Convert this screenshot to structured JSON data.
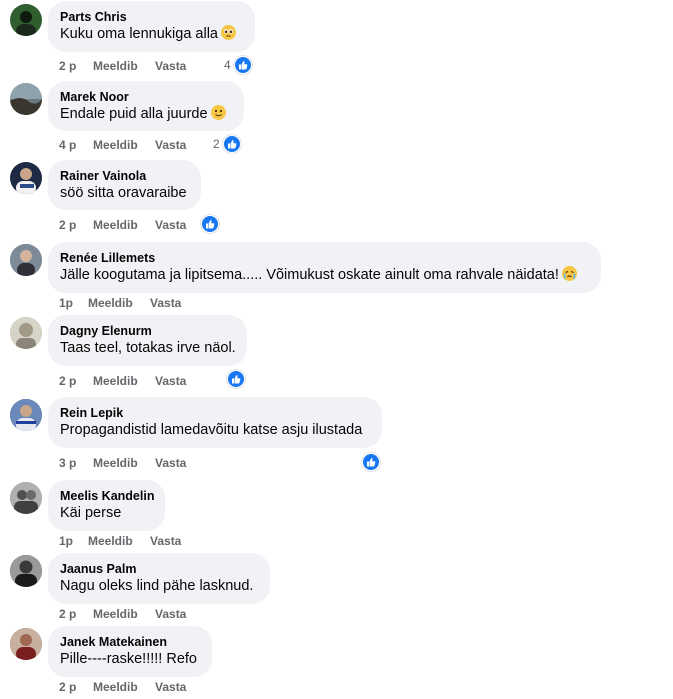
{
  "comments": [
    {
      "author": "Parts Chris",
      "text": "Kuku oma lennukiga alla",
      "emoji": "pleading-face-icon",
      "time": "2 p",
      "like": "Meeldib",
      "reply": "Vasta",
      "reactions": "4",
      "avatar_color": "#2e5a2e"
    },
    {
      "author": "Marek Noor",
      "text": "Endale puid alla juurde",
      "emoji": "slightly-smiling-face-icon",
      "time": "4 p",
      "like": "Meeldib",
      "reply": "Vasta",
      "reactions": "2",
      "avatar_color": "#6b7a80"
    },
    {
      "author": "Rainer Vainola",
      "text": "söö sitta oravaraibe",
      "emoji": "",
      "time": "2 p",
      "like": "Meeldib",
      "reply": "Vasta",
      "reactions": "",
      "avatar_color": "#1e2a44"
    },
    {
      "author": "Renée Lillemets",
      "text": "Jälle koogutama ja lipitsema..... Võimukust oskate ainult oma rahvale näidata!",
      "emoji": "crying-face-icon",
      "time": "1p",
      "like": "Meeldib",
      "reply": "Vasta",
      "reactions": "",
      "avatar_color": "#5b6470"
    },
    {
      "author": "Dagny Elenurm",
      "text": "Taas teel, totakas irve näol.",
      "emoji": "",
      "time": "2 p",
      "like": "Meeldib",
      "reply": "Vasta",
      "reactions": "",
      "avatar_color": "#b8b8a8"
    },
    {
      "author": "Rein Lepik",
      "text": "Propagandistid lamedavõitu katse asju ilustada",
      "emoji": "",
      "time": "3 p",
      "like": "Meeldib",
      "reply": "Vasta",
      "reactions": "",
      "avatar_color": "#3d5a8a"
    },
    {
      "author": "Meelis Kandelin",
      "text": "Käi perse",
      "emoji": "",
      "time": "1p",
      "like": "Meeldib",
      "reply": "Vasta",
      "reactions": "",
      "avatar_color": "#8a8a8a"
    },
    {
      "author": "Jaanus Palm",
      "text": "Nagu oleks lind pähe lasknud.",
      "emoji": "",
      "time": "2 p",
      "like": "Meeldib",
      "reply": "Vasta",
      "reactions": "",
      "avatar_color": "#2a2a2a"
    },
    {
      "author": "Janek Matekainen",
      "text": "Pille----raske!!!!! Refo",
      "emoji": "",
      "time": "2 p",
      "like": "Meeldib",
      "reply": "Vasta",
      "reactions": "",
      "avatar_color": "#7a4a3a"
    }
  ],
  "colors": {
    "bubble": "#f0f2f5",
    "meta": "#65676b",
    "like_blue": "#1877f2"
  }
}
